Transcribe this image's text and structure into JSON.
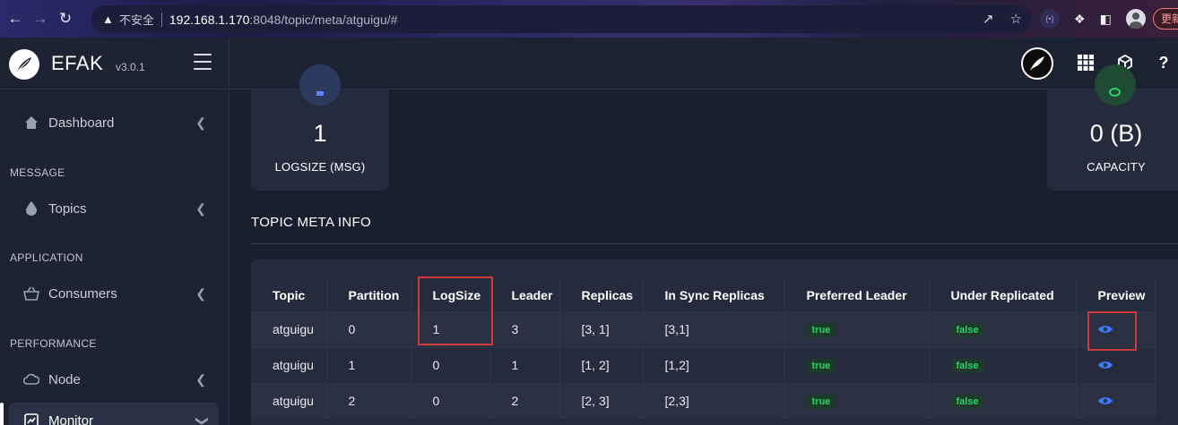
{
  "browser": {
    "warning_label": "不安全",
    "url_host": "192.168.1.170",
    "url_rest": ":8048/topic/meta/atguigu/#",
    "update_label": "更新"
  },
  "app": {
    "name": "EFAK",
    "version": "v3.0.1"
  },
  "sidebar": {
    "items": [
      {
        "label": "Dashboard",
        "icon": "home-icon"
      },
      {
        "section": "MESSAGE"
      },
      {
        "label": "Topics",
        "icon": "drop-icon"
      },
      {
        "section": "APPLICATION"
      },
      {
        "label": "Consumers",
        "icon": "basket-icon"
      },
      {
        "section": "PERFORMANCE"
      },
      {
        "label": "Node",
        "icon": "cloud-icon"
      },
      {
        "label": "Monitor",
        "icon": "chart-icon"
      }
    ]
  },
  "cards": {
    "logsize": {
      "value": "1",
      "label": "LOGSIZE (MSG)"
    },
    "capacity": {
      "value": "0 (B)",
      "label": "CAPACITY"
    }
  },
  "section_title": "TOPIC META INFO",
  "table": {
    "headers": [
      "Topic",
      "Partition",
      "LogSize",
      "Leader",
      "Replicas",
      "In Sync Replicas",
      "Preferred Leader",
      "Under Replicated",
      "Preview"
    ],
    "rows": [
      [
        "atguigu",
        "0",
        "1",
        "3",
        "[3, 1]",
        "[3,1]",
        "true",
        "false"
      ],
      [
        "atguigu",
        "1",
        "0",
        "1",
        "[1, 2]",
        "[1,2]",
        "true",
        "false"
      ],
      [
        "atguigu",
        "2",
        "0",
        "2",
        "[2, 3]",
        "[2,3]",
        "true",
        "false"
      ]
    ]
  },
  "colors": {
    "accent_blue": "#3d7dff",
    "badge_green": "#2fd36a",
    "highlight_red": "#d23a3a"
  }
}
